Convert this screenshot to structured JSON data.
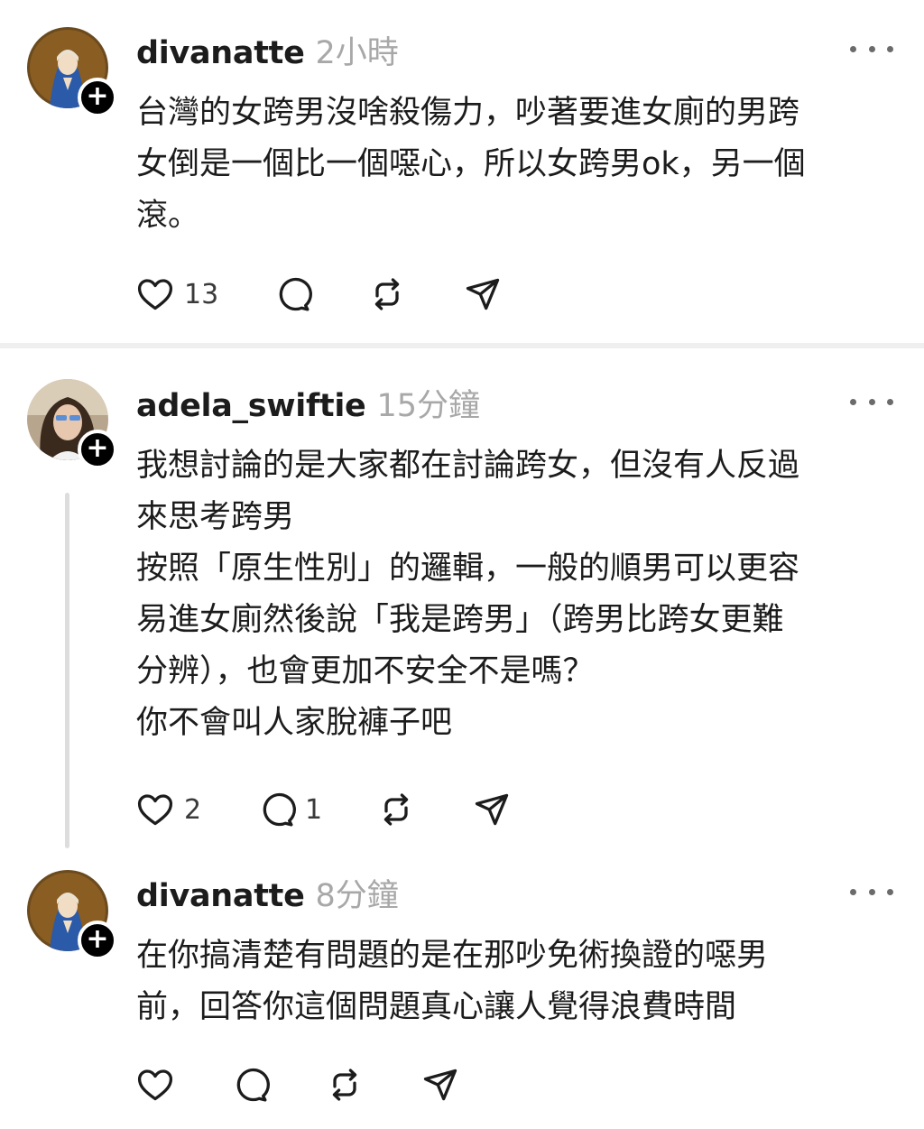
{
  "posts": [
    {
      "username": "divanatte",
      "time": "2小時",
      "text": "台灣的女跨男沒啥殺傷力，吵著要進女廁的男跨\n女倒是一個比一個噁心，所以女跨男ok，另一個\n滾。",
      "likes": "13",
      "replies": "",
      "follow_label": "+"
    },
    {
      "username": "adela_swiftie",
      "time": "15分鐘",
      "text": "我想討論的是大家都在討論跨女，但沒有人反過\n來思考跨男\n按照「原生性別」的邏輯，一般的順男可以更容\n易進女廁然後說「我是跨男」（跨男比跨女更難\n分辨），也會更加不安全不是嗎？\n你不會叫人家脫褲子吧",
      "likes": "2",
      "replies": "1",
      "follow_label": "+"
    },
    {
      "username": "divanatte",
      "time": "8分鐘",
      "text": "在你搞清楚有問題的是在那吵免術換證的噁男\n前，回答你這個問題真心讓人覺得浪費時間",
      "likes": "",
      "replies": "",
      "follow_label": "+"
    }
  ],
  "icons": {
    "like": "heart-icon",
    "reply": "comment-bubble-icon",
    "repost": "repost-icon",
    "share": "send-icon",
    "more": "more-dots-icon"
  },
  "colors": {
    "text": "#1c1c1c",
    "muted": "#a8a8a8",
    "divider": "#efefef"
  }
}
